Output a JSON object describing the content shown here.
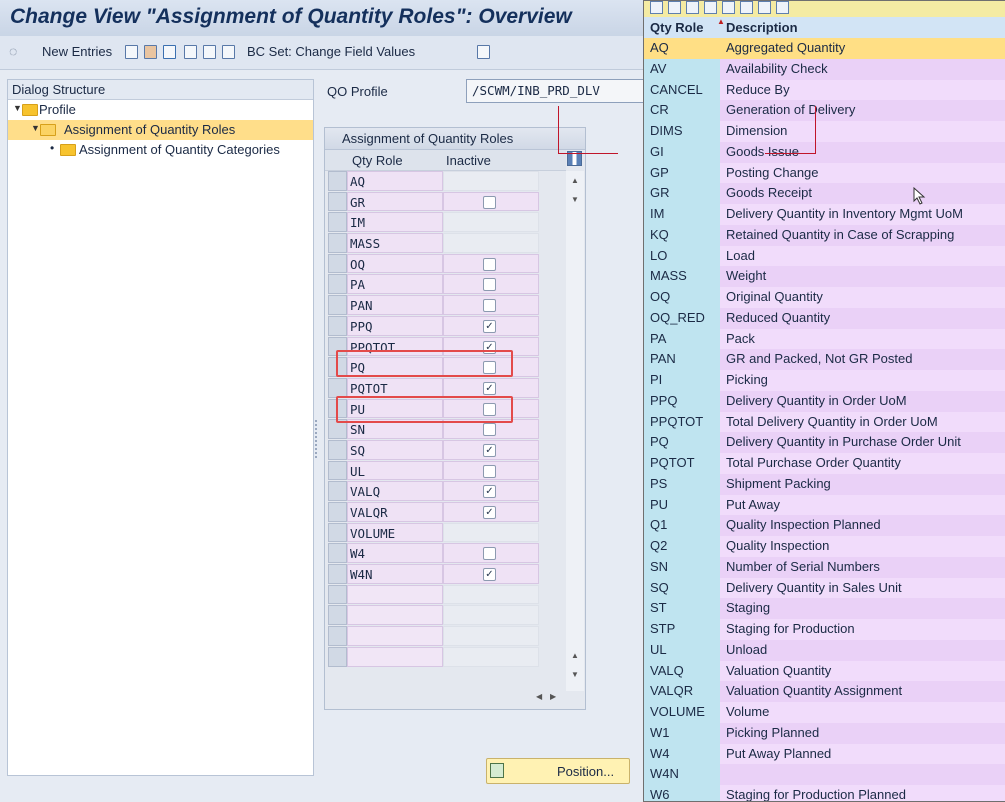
{
  "window": {
    "title": "Change View \"Assignment of Quantity Roles\": Overview"
  },
  "toolbar": {
    "new_entries_label": "New Entries",
    "bc_set_label": "BC Set: Change Field Values"
  },
  "dialog_structure": {
    "header": "Dialog Structure",
    "items": [
      {
        "label": "Profile",
        "level": 0,
        "selected": false
      },
      {
        "label": "Assignment of Quantity Roles",
        "level": 1,
        "selected": true
      },
      {
        "label": "Assignment of Quantity Categories",
        "level": 2,
        "selected": false
      }
    ]
  },
  "qo_profile": {
    "label": "QO Profile",
    "value": "/SCWM/INB_PRD_DLV"
  },
  "table": {
    "title": "Assignment of Quantity Roles",
    "columns": [
      "Qty Role",
      "Inactive"
    ],
    "rows": [
      {
        "role": "AQ",
        "inactive": null
      },
      {
        "role": "GR",
        "inactive": false
      },
      {
        "role": "IM",
        "inactive": null
      },
      {
        "role": "MASS",
        "inactive": null
      },
      {
        "role": "OQ",
        "inactive": false
      },
      {
        "role": "PA",
        "inactive": false
      },
      {
        "role": "PAN",
        "inactive": false
      },
      {
        "role": "PPQ",
        "inactive": true
      },
      {
        "role": "PPQTOT",
        "inactive": true
      },
      {
        "role": "PQ",
        "inactive": false
      },
      {
        "role": "PQTOT",
        "inactive": true
      },
      {
        "role": "PU",
        "inactive": false
      },
      {
        "role": "SN",
        "inactive": false
      },
      {
        "role": "SQ",
        "inactive": true
      },
      {
        "role": "UL",
        "inactive": false
      },
      {
        "role": "VALQ",
        "inactive": true
      },
      {
        "role": "VALQR",
        "inactive": true
      },
      {
        "role": "VOLUME",
        "inactive": null
      },
      {
        "role": "W4",
        "inactive": false
      },
      {
        "role": "W4N",
        "inactive": true
      },
      {
        "role": "",
        "inactive": null
      },
      {
        "role": "",
        "inactive": null
      },
      {
        "role": "",
        "inactive": null
      },
      {
        "role": "",
        "inactive": null
      }
    ],
    "highlighted_rows": [
      "PPQTOT",
      "PQTOT"
    ]
  },
  "position_button": {
    "label": "Position..."
  },
  "popup": {
    "columns": [
      "Qty Role",
      "Description"
    ],
    "rows": [
      {
        "role": "AQ",
        "description": "Aggregated Quantity"
      },
      {
        "role": "AV",
        "description": "Availability Check"
      },
      {
        "role": "CANCEL",
        "description": "Reduce By"
      },
      {
        "role": "CR",
        "description": "Generation of Delivery"
      },
      {
        "role": "DIMS",
        "description": "Dimension"
      },
      {
        "role": "GI",
        "description": "Goods Issue"
      },
      {
        "role": "GP",
        "description": "Posting Change"
      },
      {
        "role": "GR",
        "description": "Goods Receipt"
      },
      {
        "role": "IM",
        "description": "Delivery Quantity in Inventory Mgmt UoM"
      },
      {
        "role": "KQ",
        "description": "Retained Quantity in Case of Scrapping"
      },
      {
        "role": "LO",
        "description": "Load"
      },
      {
        "role": "MASS",
        "description": "Weight"
      },
      {
        "role": "OQ",
        "description": "Original Quantity"
      },
      {
        "role": "OQ_RED",
        "description": "Reduced Quantity"
      },
      {
        "role": "PA",
        "description": "Pack"
      },
      {
        "role": "PAN",
        "description": "GR and Packed, Not GR Posted"
      },
      {
        "role": "PI",
        "description": "Picking"
      },
      {
        "role": "PPQ",
        "description": "Delivery Quantity in Order UoM"
      },
      {
        "role": "PPQTOT",
        "description": "Total Delivery Quantity in Order UoM"
      },
      {
        "role": "PQ",
        "description": "Delivery Quantity in Purchase Order Unit"
      },
      {
        "role": "PQTOT",
        "description": "Total Purchase Order Quantity"
      },
      {
        "role": "PS",
        "description": "Shipment Packing"
      },
      {
        "role": "PU",
        "description": "Put Away"
      },
      {
        "role": "Q1",
        "description": "Quality Inspection Planned"
      },
      {
        "role": "Q2",
        "description": "Quality Inspection"
      },
      {
        "role": "SN",
        "description": "Number of Serial Numbers"
      },
      {
        "role": "SQ",
        "description": "Delivery Quantity in Sales Unit"
      },
      {
        "role": "ST",
        "description": "Staging"
      },
      {
        "role": "STP",
        "description": "Staging for Production"
      },
      {
        "role": "UL",
        "description": "Unload"
      },
      {
        "role": "VALQ",
        "description": "Valuation Quantity"
      },
      {
        "role": "VALQR",
        "description": "Valuation Quantity Assignment"
      },
      {
        "role": "VOLUME",
        "description": "Volume"
      },
      {
        "role": "W1",
        "description": "Picking Planned"
      },
      {
        "role": "W4",
        "description": "Put Away Planned"
      },
      {
        "role": "W4N",
        "description": ""
      },
      {
        "role": "W6",
        "description": "Staging for Production Planned"
      }
    ]
  }
}
